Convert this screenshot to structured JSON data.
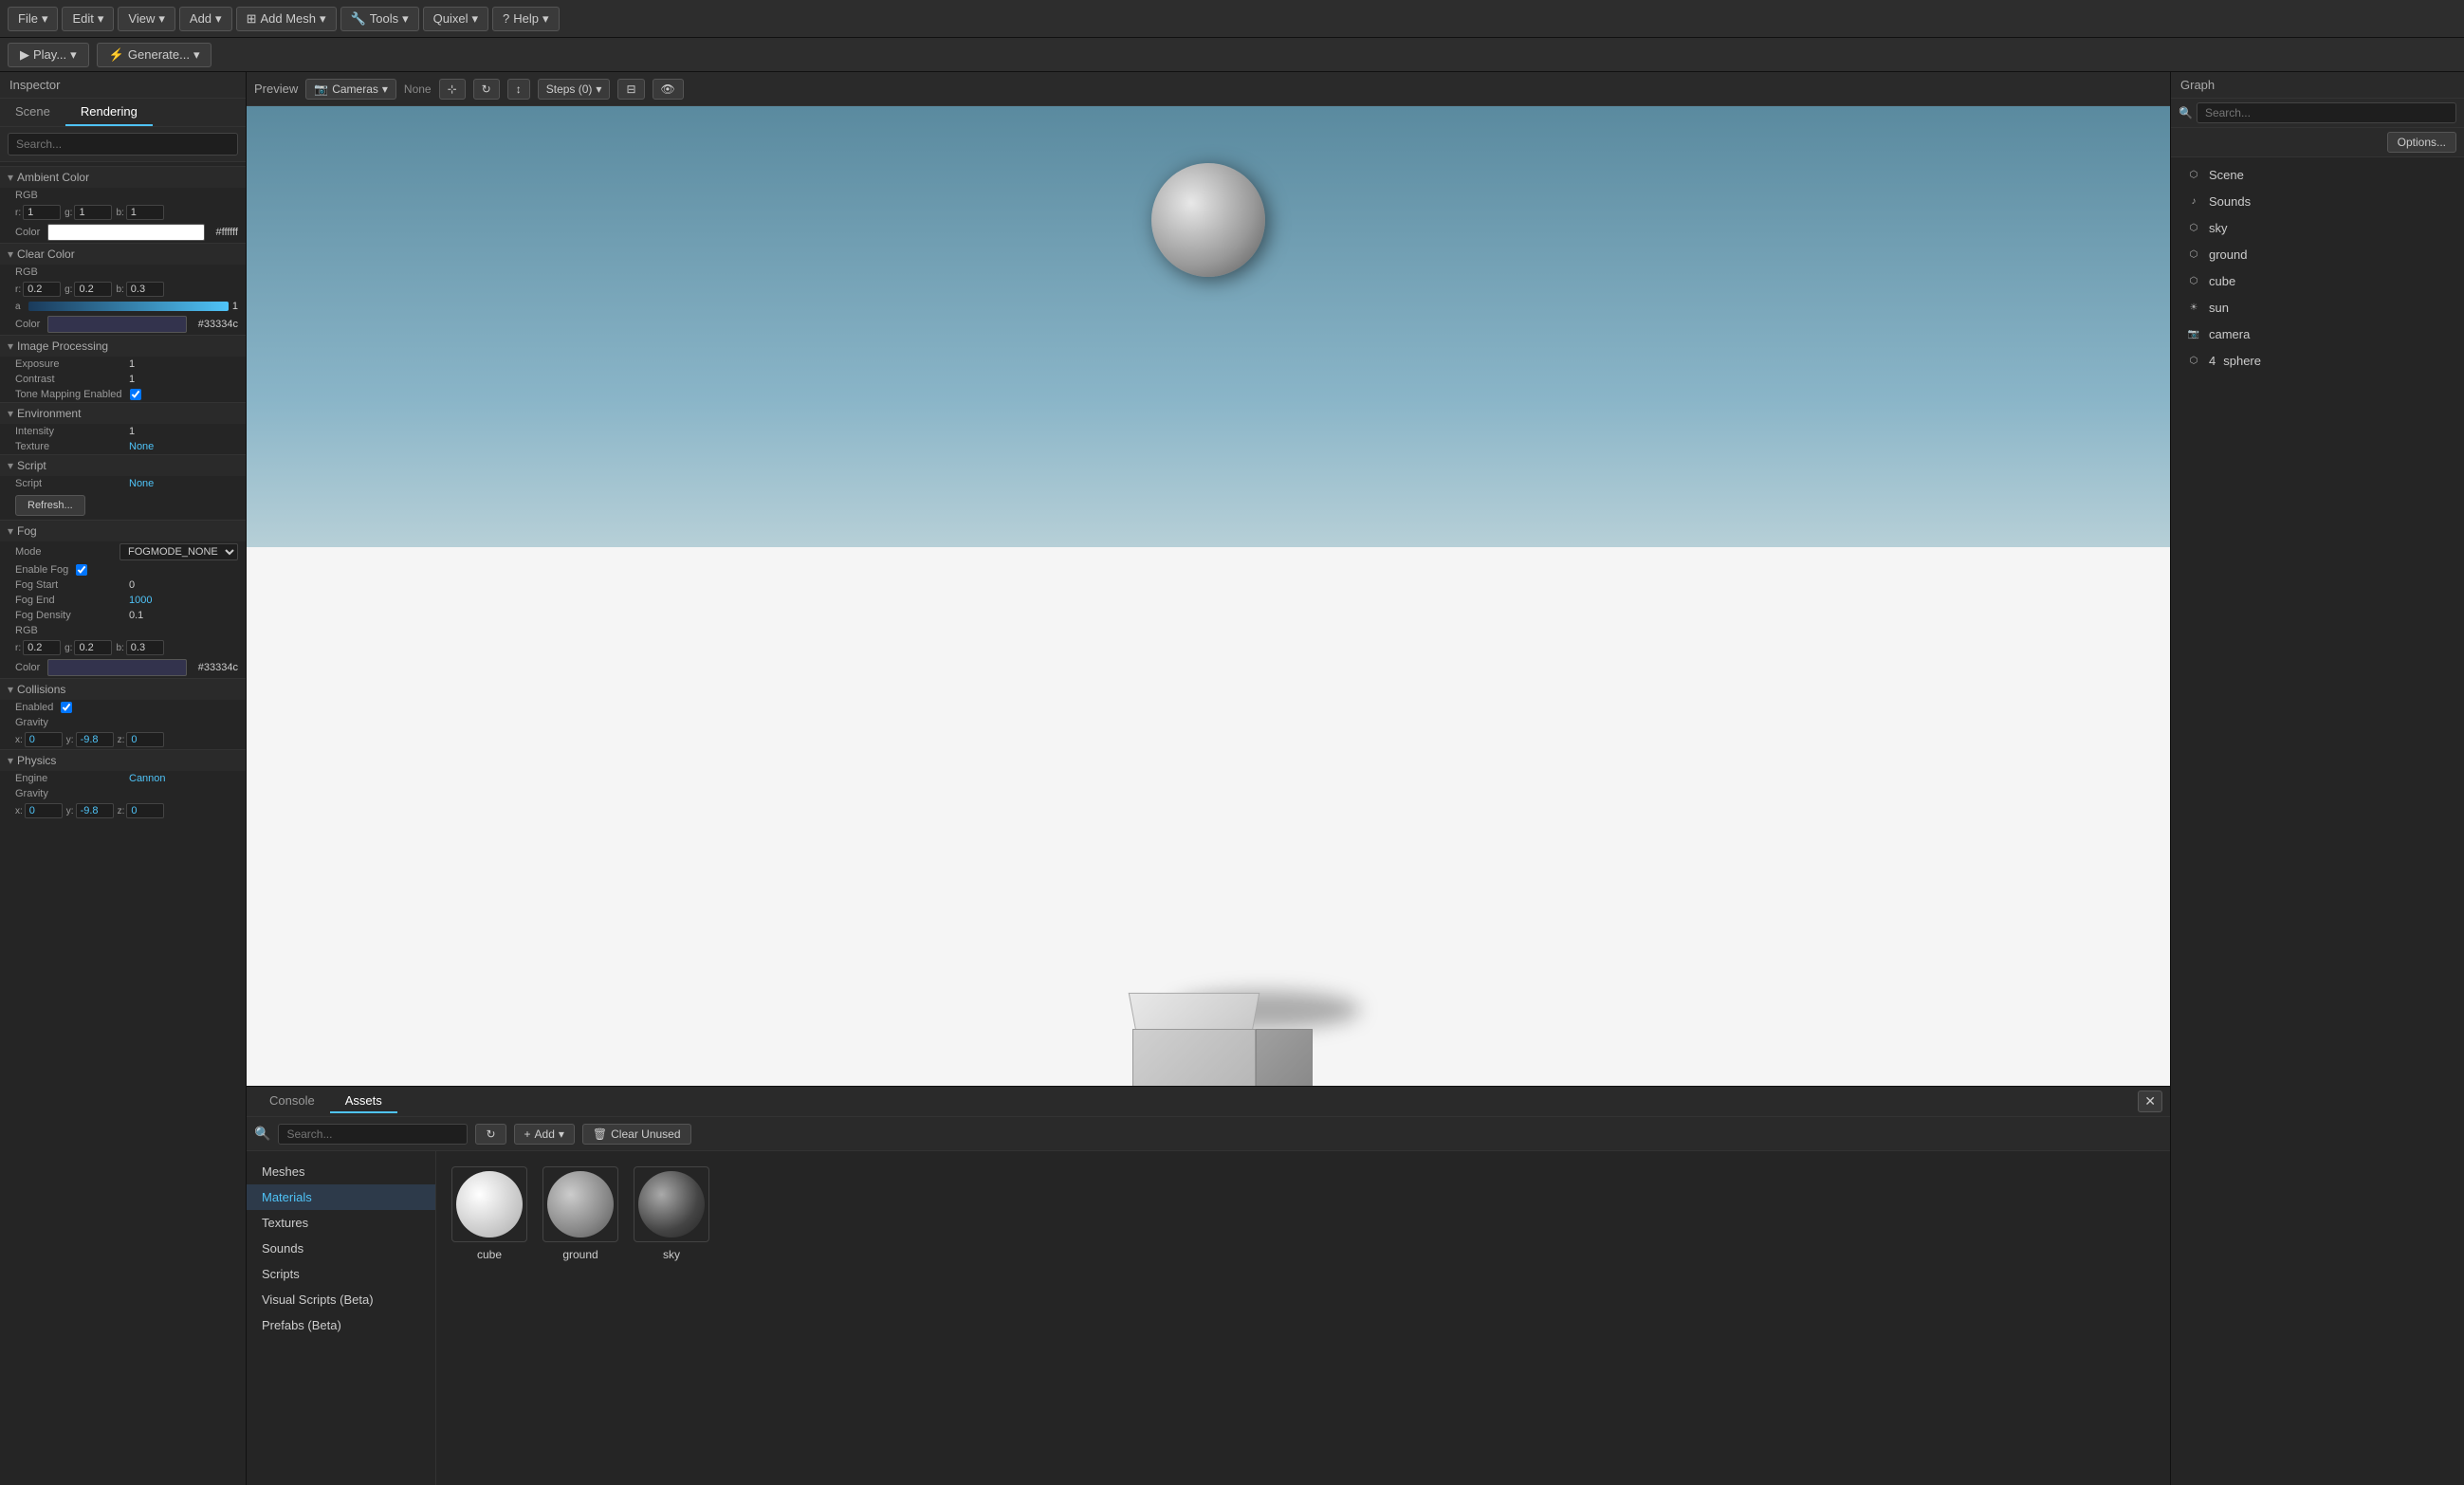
{
  "topToolbar": {
    "file": "File",
    "edit": "Edit",
    "view": "View",
    "add": "Add",
    "addMesh": "Add Mesh",
    "tools": "Tools",
    "quixel": "Quixel",
    "help": "Help"
  },
  "secondToolbar": {
    "play": "Play...",
    "generate": "Generate..."
  },
  "inspector": {
    "title": "Inspector",
    "tabs": [
      "Scene",
      "Rendering"
    ],
    "activeTab": "Rendering",
    "searchPlaceholder": "Search...",
    "sections": {
      "ambientColor": {
        "label": "Ambient Color",
        "rgb": {
          "r": "1",
          "g": "1",
          "b": "1"
        },
        "color": "#ffffff"
      },
      "clearColor": {
        "label": "Clear Color",
        "rgb": {
          "r": "0.2",
          "g": "0.2",
          "b": "0.3"
        },
        "alpha": "1",
        "color": "#33334c"
      },
      "imageProcessing": {
        "label": "Image Processing",
        "exposure": "1",
        "contrast": "1",
        "toneMappingEnabled": true
      },
      "environment": {
        "label": "Environment",
        "intensity": "1",
        "texture": "None"
      },
      "script": {
        "label": "Script",
        "script": "None",
        "refresh": "Refresh..."
      },
      "fog": {
        "label": "Fog",
        "mode": "FOGMODE_NONE",
        "enableFog": true,
        "fogStart": "0",
        "fogEnd": "1000",
        "fogDensity": "0.1",
        "colorRgb": {
          "r": "0.2",
          "g": "0.2",
          "b": "0.3"
        },
        "color": "#33334c"
      },
      "collisions": {
        "label": "Collisions",
        "enabled": true,
        "gravity": {
          "x": "0",
          "y": "-9.8",
          "z": "0"
        }
      },
      "physics": {
        "label": "Physics",
        "engine": "Cannon",
        "gravity": {
          "x": "0",
          "y": "-9.8",
          "z": "0"
        }
      }
    }
  },
  "preview": {
    "title": "Preview",
    "cameras": "Cameras",
    "none": "None",
    "steps": "Steps (0)"
  },
  "bottomPanel": {
    "tabs": [
      "Console",
      "Assets"
    ],
    "activeTab": "Assets",
    "searchPlaceholder": "Search...",
    "addBtn": "Add",
    "clearUnusedBtn": "Clear Unused",
    "categories": [
      {
        "label": "Meshes",
        "active": false
      },
      {
        "label": "Materials",
        "active": true
      },
      {
        "label": "Textures",
        "active": false
      },
      {
        "label": "Sounds",
        "active": false
      },
      {
        "label": "Scripts",
        "active": false
      },
      {
        "label": "Visual Scripts (Beta)",
        "active": false
      },
      {
        "label": "Prefabs (Beta)",
        "active": false
      }
    ],
    "materials": [
      {
        "name": "cube",
        "type": "white"
      },
      {
        "name": "ground",
        "type": "gray"
      },
      {
        "name": "sky",
        "type": "dark"
      }
    ]
  },
  "graph": {
    "title": "Graph",
    "searchPlaceholder": "Search...",
    "optionsBtn": "Options...",
    "items": [
      {
        "icon": "scene",
        "label": "Scene",
        "num": ""
      },
      {
        "icon": "audio",
        "label": "Sounds",
        "num": ""
      },
      {
        "icon": "sky",
        "label": "sky",
        "num": ""
      },
      {
        "icon": "ground",
        "label": "ground",
        "num": ""
      },
      {
        "icon": "cube",
        "label": "cube",
        "num": ""
      },
      {
        "icon": "sun",
        "label": "sun",
        "num": ""
      },
      {
        "icon": "camera",
        "label": "camera",
        "num": ""
      },
      {
        "icon": "sphere",
        "label": "sphere",
        "num": "4 "
      }
    ]
  }
}
